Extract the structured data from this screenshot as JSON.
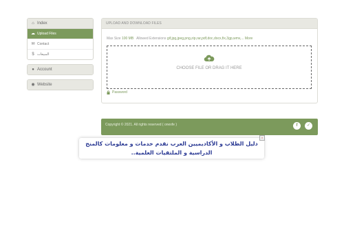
{
  "sidebar": {
    "index": {
      "label": "Index",
      "icon": "home-icon",
      "items": [
        {
          "label": "Upload Files",
          "icon": "upload-cloud-icon",
          "active": true
        },
        {
          "label": "Contact",
          "icon": "envelope-icon",
          "active": false
        },
        {
          "label": "المبيعات",
          "icon": "dollar-icon",
          "active": false
        }
      ]
    },
    "account": {
      "label": "Account",
      "icon": "user-icon"
    },
    "website": {
      "label": "Website",
      "icon": "globe-icon"
    }
  },
  "upload": {
    "title": "UPLOAD AND DOWNLOAD FILES",
    "max_size_label": "Max Size",
    "max_size_value": "100 MB",
    "allowed_label": "Allowed Extensions",
    "allowed_value": "gif,jpg,jpeg,png,zip,rar,pdf,doc,docx,fix,3gp,wmv,...",
    "more": "More",
    "dropzone_text": "CHOOSE FILE OR DRAG IT HERE",
    "password_label": "Password"
  },
  "footer": {
    "copyright": "Copyright © 2021. All rights reserved ( onexfe )"
  },
  "ad": {
    "text": "دليل الطلاب و الأكاديميين العرب نقدم خدمات و معلومات كالمنح الدراسية و الملتقيات العلمية.."
  },
  "colors": {
    "accent": "#7c9a5c",
    "panel_head": "#e8e8e2",
    "ad_text": "#2b3a94"
  }
}
